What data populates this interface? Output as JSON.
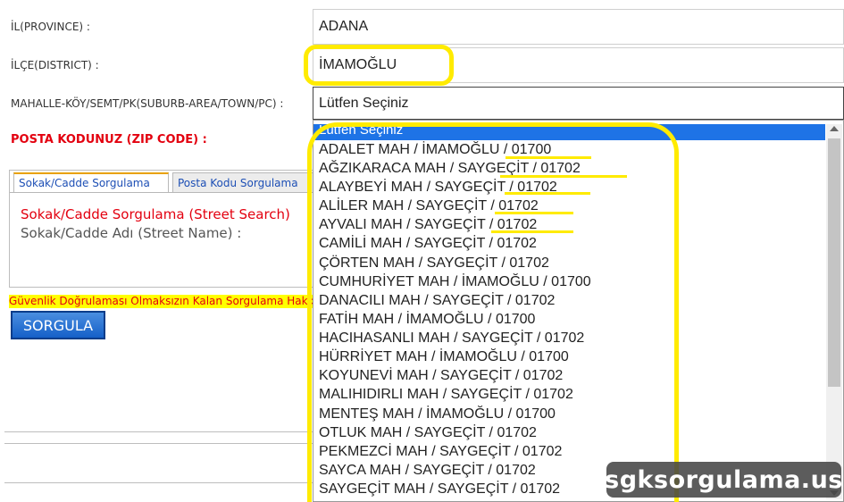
{
  "form": {
    "province_label": "İL(PROVINCE) :",
    "province_value": "ADANA",
    "district_label": "İLÇE(DISTRICT) :",
    "district_value": "İMAMOĞLU",
    "suburb_label": "MAHALLE-KÖY/SEMT/PK(SUBURB-AREA/TOWN/PC) :",
    "suburb_value": "Lütfen Seçiniz",
    "zip_label": "POSTA KODUNUZ (ZIP CODE) :"
  },
  "tabs": [
    {
      "label": "Sokak/Cadde Sorgulama"
    },
    {
      "label": "Posta Kodu Sorgulama"
    }
  ],
  "tab_content": {
    "title": "Sokak/Cadde Sorgulama (Street Search)",
    "street_label": "Sokak/Cadde Adı (Street Name) :"
  },
  "warning_text": "Güvenlik Doğrulaması Olmaksızın Kalan Sorgulama Hakkınız",
  "query_button": "SORGULA",
  "dropdown": {
    "selected": "Lütfen Seçiniz",
    "options": [
      "ADALET MAH / İMAMOĞLU / 01700",
      "AĞZIKARACA MAH / SAYGEÇİT / 01702",
      "ALAYBEYİ MAH / SAYGEÇİT / 01702",
      "ALİLER MAH / SAYGEÇİT / 01702",
      "AYVALI MAH / SAYGEÇİT / 01702",
      "CAMİLİ MAH / SAYGEÇİT / 01702",
      "ÇÖRTEN MAH / SAYGEÇİT / 01702",
      "CUMHURİYET MAH / İMAMOĞLU / 01700",
      "DANACILI MAH / SAYGEÇİT / 01702",
      "FATİH MAH / İMAMOĞLU / 01700",
      "HACIHASANLI MAH / SAYGEÇİT / 01702",
      "HÜRRİYET MAH / İMAMOĞLU / 01700",
      "KOYUNEVİ MAH / SAYGEÇİT / 01702",
      "MALIHIDIRLI MAH / SAYGEÇİT / 01702",
      "MENTEŞ MAH / İMAMOĞLU / 01700",
      "OTLUK MAH / SAYGEÇİT / 01702",
      "PEKMEZCİ MAH / SAYGEÇİT / 01702",
      "SAYCA MAH / SAYGEÇİT / 01702",
      "SAYGEÇİT MAH / SAYGEÇİT / 01702"
    ]
  },
  "watermark": "sgksorgulama.us",
  "colors": {
    "highlight": "#ffeb00",
    "accent_red": "#e3000f",
    "selection_blue": "#1e73e6",
    "button_blue": "#1560c8"
  }
}
